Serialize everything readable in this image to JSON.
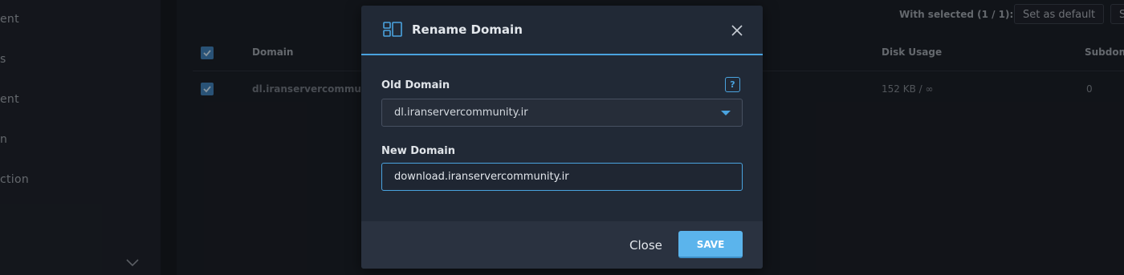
{
  "sidebar": {
    "items": [
      {
        "label": "ent"
      },
      {
        "label": "s"
      },
      {
        "label": "ent"
      },
      {
        "label": "n"
      },
      {
        "label": "ction"
      }
    ]
  },
  "toolbar": {
    "with_selected": "With selected (1 / 1):",
    "set_default_label": "Set as default",
    "next_label": "S"
  },
  "table": {
    "columns": [
      "Domain",
      "Disk Usage",
      "Subdom"
    ],
    "rows": [
      {
        "domain": "dl.iranservercommunit",
        "disk_usage": "152 KB / ∞",
        "subdomains": "0"
      }
    ]
  },
  "modal": {
    "title": "Rename Domain",
    "old_domain_label": "Old Domain",
    "help_glyph": "?",
    "old_domain_value": "dl.iranservercommunity.ir",
    "new_domain_label": "New Domain",
    "new_domain_value": "download.iranservercommunity.ir",
    "close_label": "Close",
    "save_label": "SAVE"
  },
  "colors": {
    "accent": "#4aa3df",
    "save_button": "#5bb4ec",
    "checkbox": "#3f7fb5"
  }
}
